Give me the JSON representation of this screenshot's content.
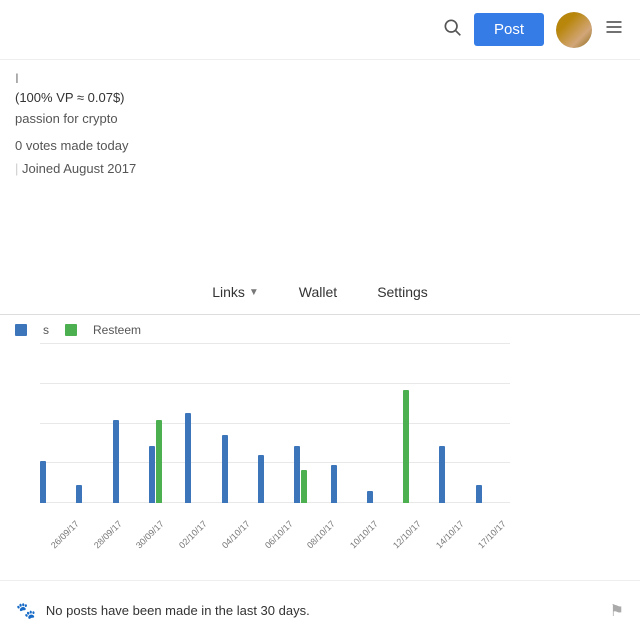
{
  "header": {
    "post_label": "Post",
    "search_icon": "🔍",
    "menu_icon": "☰"
  },
  "profile": {
    "cursor_char": "I",
    "vp_text": "(100% VP ≈ 0.07$)",
    "bio": "passion for crypto",
    "votes_text": "0 votes made today",
    "joined_text": "Joined August 2017"
  },
  "nav": {
    "links_label": "Links",
    "wallet_label": "Wallet",
    "settings_label": "Settings"
  },
  "chart": {
    "legend": {
      "posts_label": "s",
      "resteem_label": "Resteem"
    },
    "x_labels": [
      "26/09/17",
      "28/09/17",
      "30/09/17",
      "02/10/17",
      "04/10/17",
      "06/10/17",
      "08/10/17",
      "10/10/17",
      "12/10/17",
      "14/10/17",
      "17/10/17"
    ],
    "bar_groups": [
      {
        "blue": 28,
        "green": 0
      },
      {
        "blue": 12,
        "green": 0
      },
      {
        "blue": 55,
        "green": 0
      },
      {
        "blue": 38,
        "green": 55
      },
      {
        "blue": 60,
        "green": 0
      },
      {
        "blue": 45,
        "green": 0
      },
      {
        "blue": 32,
        "green": 0
      },
      {
        "blue": 38,
        "green": 22
      },
      {
        "blue": 25,
        "green": 0
      },
      {
        "blue": 8,
        "green": 0
      },
      {
        "blue": 0,
        "green": 75
      },
      {
        "blue": 38,
        "green": 0
      },
      {
        "blue": 12,
        "green": 0
      }
    ]
  },
  "footer": {
    "icon": "🐾",
    "text": "No posts have been made in the last 30 days.",
    "flag_icon": "⚑"
  }
}
